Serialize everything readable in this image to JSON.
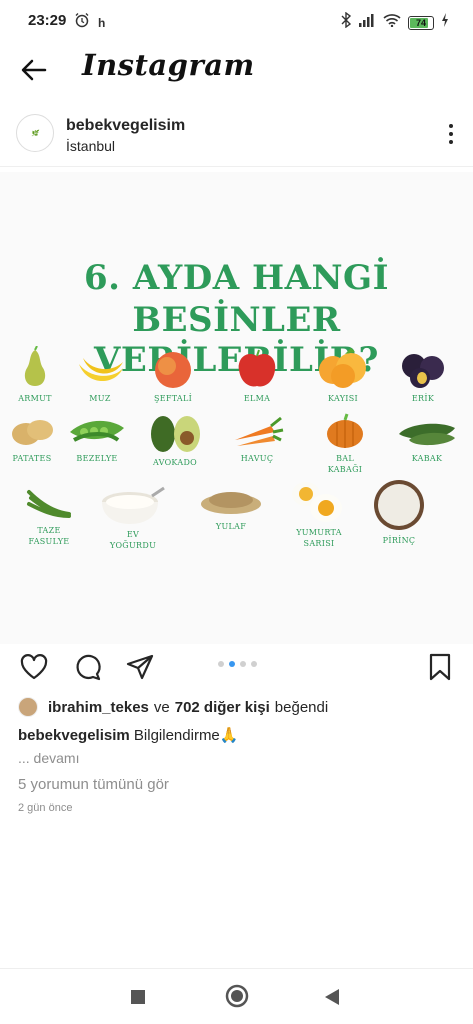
{
  "status_bar": {
    "time": "23:29",
    "alarm_icon": "alarm-icon",
    "h_label": "h",
    "battery": "74"
  },
  "header": {
    "title": "Instagram"
  },
  "post": {
    "username": "bebekvegelisim",
    "location": "İstanbul",
    "image": {
      "title_line1": "6. AYDA HANGİ",
      "title_line2": "BESİNLER VERİLEBİLİR?",
      "foods": [
        {
          "label": "ARMUT",
          "label2": ""
        },
        {
          "label": "MUZ",
          "label2": ""
        },
        {
          "label": "ŞEFTALİ",
          "label2": ""
        },
        {
          "label": "ELMA",
          "label2": ""
        },
        {
          "label": "KAYISI",
          "label2": ""
        },
        {
          "label": "ERİK",
          "label2": ""
        },
        {
          "label": "PATATES",
          "label2": ""
        },
        {
          "label": "BEZELYE",
          "label2": ""
        },
        {
          "label": "AVOKADO",
          "label2": ""
        },
        {
          "label": "HAVUÇ",
          "label2": ""
        },
        {
          "label": "BAL",
          "label2": "KABAĞI"
        },
        {
          "label": "KABAK",
          "label2": ""
        },
        {
          "label": "TAZE",
          "label2": "FASULYE"
        },
        {
          "label": "EV",
          "label2": "YOĞURDU"
        },
        {
          "label": "YULAF",
          "label2": ""
        },
        {
          "label": "YUMURTA",
          "label2": "SARISI"
        },
        {
          "label": "PİRİNÇ",
          "label2": ""
        }
      ]
    },
    "carousel": {
      "count": 4,
      "active_index": 1
    },
    "likes": {
      "first_user": "ibrahim_tekes",
      "connector": "ve",
      "others": "702 diğer kişi",
      "suffix": "beğendi"
    },
    "caption": {
      "username": "bebekvegelisim",
      "text": "Bilgilendirme🙏"
    },
    "more_label": "... devamı",
    "comments_link": "5 yorumun tümünü gör",
    "time_ago": "2 gün önce"
  },
  "colors": {
    "accent": "#3897f0",
    "image_title": "#2e9b5a",
    "muted": "#8e8e8e"
  }
}
